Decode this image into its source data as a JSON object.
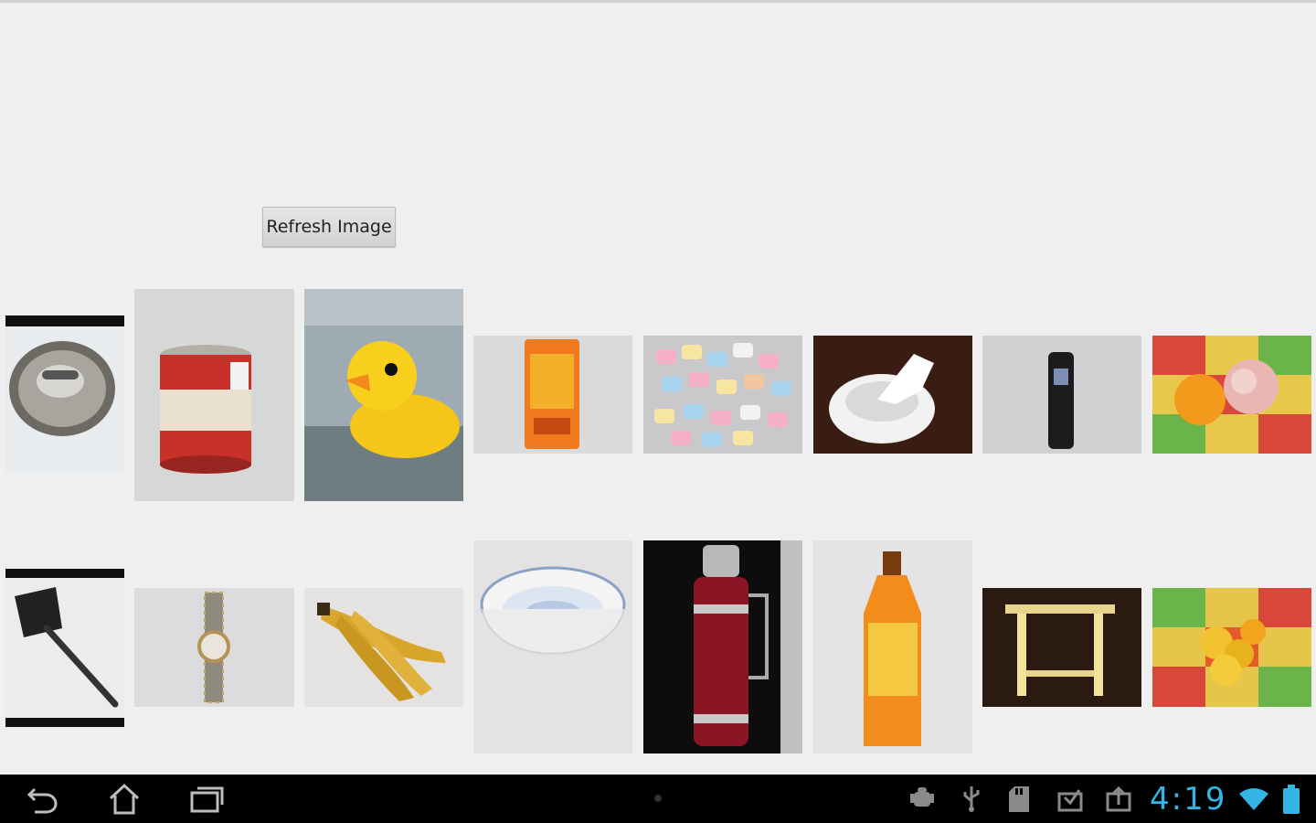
{
  "refresh_button": {
    "label": "Refresh Image"
  },
  "gallery": {
    "row1": [
      "metal-lid",
      "evaporated-milk-can",
      "rubber-duck",
      "snack-package",
      "marshmallows",
      "tissue-roll",
      "flip-phone",
      "orange-and-apple"
    ],
    "row2": [
      "spatula",
      "wristwatch",
      "bananas",
      "porcelain-bowl",
      "thermos-flask",
      "juice-bottle",
      "wooden-stool",
      "gold-coins"
    ]
  },
  "navbar": {
    "buttons": [
      "back-icon",
      "home-icon",
      "recent-apps-icon"
    ],
    "status_icons": [
      "android-debug-icon",
      "usb-icon",
      "sd-card-icon",
      "download-icon",
      "upload-icon",
      "wifi-icon",
      "battery-icon"
    ],
    "time": "4:19",
    "accent_color": "#33b5e5"
  }
}
